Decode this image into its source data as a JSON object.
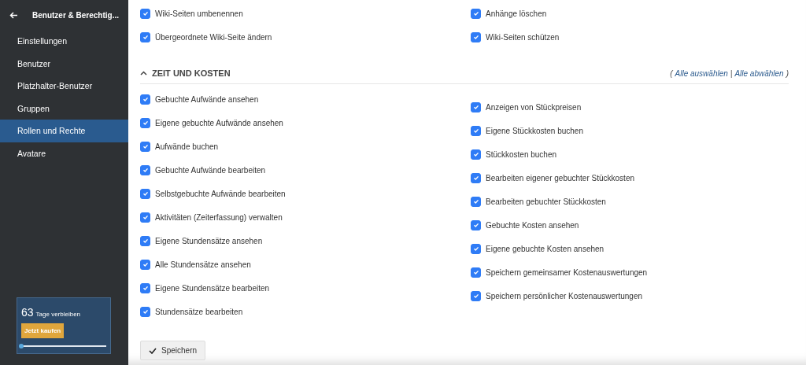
{
  "sidebar": {
    "back_title": "Benutzer & Berechtig...",
    "items": [
      {
        "label": "Einstellungen",
        "selected": false
      },
      {
        "label": "Benutzer",
        "selected": false
      },
      {
        "label": "Platzhalter-Benutzer",
        "selected": false
      },
      {
        "label": "Gruppen",
        "selected": false
      },
      {
        "label": "Rollen und Rechte",
        "selected": true
      },
      {
        "label": "Avatare",
        "selected": false
      }
    ],
    "trial": {
      "days": "63",
      "text": "Tage verbleiben",
      "button": "Jetzt kaufen",
      "level": 0
    }
  },
  "previous_section": {
    "left": [
      {
        "label": "Wiki-Seiten umbenennen",
        "checked": true
      },
      {
        "label": "Übergeordnete Wiki-Seite ändern",
        "checked": true
      }
    ],
    "right": [
      {
        "label": "Anhänge löschen",
        "checked": true
      },
      {
        "label": "Wiki-Seiten schützen",
        "checked": true
      }
    ]
  },
  "section": {
    "title": "ZEIT UND KOSTEN",
    "expanded": true,
    "select_all": "Alle auswählen",
    "separator": "|",
    "deselect_all": "Alle abwählen",
    "open_paren": "(",
    "close_paren": ")",
    "left": [
      {
        "label": "Gebuchte Aufwände ansehen",
        "checked": true
      },
      {
        "label": "Eigene gebuchte Aufwände ansehen",
        "checked": true
      },
      {
        "label": "Aufwände buchen",
        "checked": true
      },
      {
        "label": "Gebuchte Aufwände bearbeiten",
        "checked": true
      },
      {
        "label": "Selbstgebuchte Aufwände bearbeiten",
        "checked": true
      },
      {
        "label": "Aktivitäten (Zeiterfassung) verwalten",
        "checked": true
      },
      {
        "label": "Eigene Stundensätze ansehen",
        "checked": true
      },
      {
        "label": "Alle Stundensätze ansehen",
        "checked": true
      },
      {
        "label": "Eigene Stundensätze bearbeiten",
        "checked": true
      },
      {
        "label": "Stundensätze bearbeiten",
        "checked": true
      }
    ],
    "right": [
      {
        "label": "Anzeigen von Stückpreisen",
        "checked": true
      },
      {
        "label": "Eigene Stückkosten buchen",
        "checked": true
      },
      {
        "label": "Stückkosten buchen",
        "checked": true
      },
      {
        "label": "Bearbeiten eigener gebuchter Stückkosten",
        "checked": true
      },
      {
        "label": "Bearbeiten gebuchter Stückkosten",
        "checked": true
      },
      {
        "label": "Gebuchte Kosten ansehen",
        "checked": true
      },
      {
        "label": "Eigene gebuchte Kosten ansehen",
        "checked": true
      },
      {
        "label": "Speichern gemeinsamer Kostenauswertungen",
        "checked": true
      },
      {
        "label": "Speichern persönlicher Kostenauswertungen",
        "checked": true
      }
    ]
  },
  "save_button": "Speichern"
}
